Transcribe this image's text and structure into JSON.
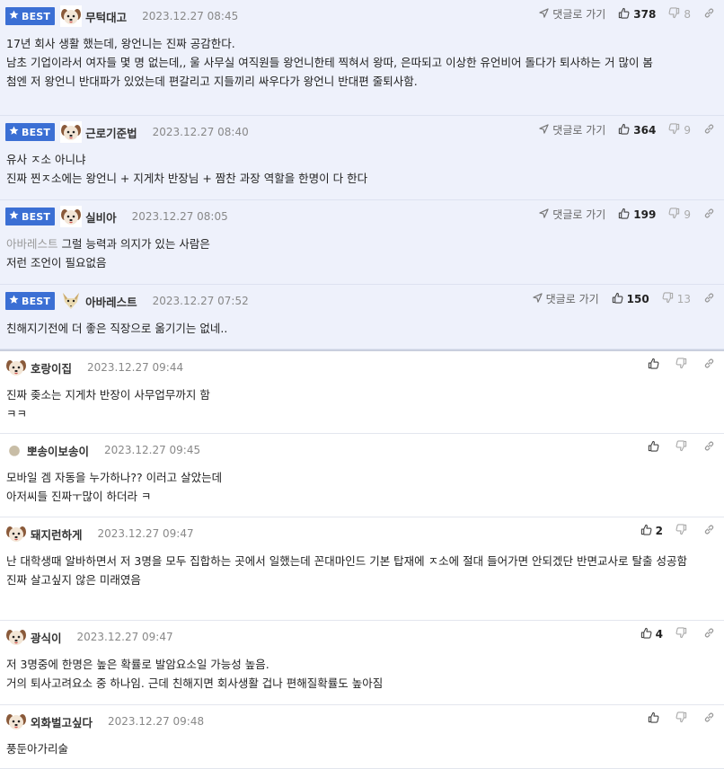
{
  "ui": {
    "best_label": "BEST",
    "reply_label": "댓글로 가기"
  },
  "comments": [
    {
      "best": true,
      "avatar": "puppy",
      "nick": "무턱대고",
      "date": "2023.12.27 08:45",
      "up": "378",
      "down": "8",
      "lines": [
        "17년 회사 생활 했는데, 왕언니는 진짜 공감한다.",
        "남초 기업이라서 여자들 몇 명 없는데,, 울 사무실 여직원들 왕언니한테 찍혀서 왕따, 은따되고 이상한 유언비어 돌다가 퇴사하는 거 많이 봄",
        "첨엔 저 왕언니 반대파가 있었는데 편갈리고 지들끼리 싸우다가 왕언니 반대편 줄퇴사함."
      ]
    },
    {
      "best": true,
      "avatar": "puppy",
      "nick": "근로기준법",
      "date": "2023.12.27 08:40",
      "up": "364",
      "down": "9",
      "lines": [
        "유사 ㅈ소 아니냐",
        "진짜 찐ㅈ소에는 왕언니 + 지게차 반장님 + 짬찬 과장 역할을 한명이 다 한다"
      ]
    },
    {
      "best": true,
      "avatar": "puppy",
      "nick": "실비아",
      "date": "2023.12.27 08:05",
      "up": "199",
      "down": "9",
      "mention": "아바레스트",
      "lines": [
        "그럴 능력과 의지가 있는 사람은",
        "저런 조언이 필요없음"
      ]
    },
    {
      "best": true,
      "avatar": "fox",
      "nick": "아바레스트",
      "date": "2023.12.27 07:52",
      "up": "150",
      "down": "13",
      "lines": [
        "친해지기전에 더 좋은 직장으로 옮기기는 없네.."
      ]
    },
    {
      "best": false,
      "avatar": "puppy",
      "nick": "호랑이집",
      "date": "2023.12.27 09:44",
      "up": "",
      "down": "",
      "lines": [
        "진짜 좆소는 지게차 반장이 사무업무까지 함",
        "ㅋㅋ"
      ]
    },
    {
      "best": false,
      "avatar": "dot",
      "nick": "뽀송이보송이",
      "date": "2023.12.27 09:45",
      "up": "",
      "down": "",
      "lines": [
        "모바일 겜 자동을 누가하나?? 이러고 살았는데",
        "아저씨들 진짜ㅜ많이 하더라 ㅋ"
      ]
    },
    {
      "best": false,
      "avatar": "puppy",
      "nick": "돼지런하게",
      "date": "2023.12.27 09:47",
      "up": "2",
      "down": "",
      "lines": [
        "난 대학생때 알바하면서 저 3명을 모두 집합하는 곳에서 일했는데 꼰대마인드 기본 탑재에 ㅈ소에 절대 들어가면 안되겠단 반면교사로 탈출 성공함",
        "진짜 살고싶지 않은 미래였음"
      ]
    },
    {
      "best": false,
      "avatar": "puppy",
      "nick": "광식이",
      "date": "2023.12.27 09:47",
      "up": "4",
      "down": "",
      "lines": [
        "저 3명중에 한명은 높은 확률로 발암요소일 가능성 높음.",
        "거의 퇴사고려요소 중 하나임. 근데 친해지면 회사생활 겁나 편해질확률도 높아짐"
      ]
    },
    {
      "best": false,
      "avatar": "puppy",
      "nick": "외화벌고싶다",
      "date": "2023.12.27 09:48",
      "up": "",
      "down": "",
      "lines": [
        "풍둔아가리술"
      ]
    }
  ],
  "icons": {
    "badge_star": "star-icon",
    "reply": "arrow-icon",
    "upvote": "thumbs-up-icon",
    "downvote": "thumbs-down-icon",
    "share": "link-icon",
    "avatar_puppy": "puppy-avatar-icon",
    "avatar_fox": "fox-avatar-icon",
    "avatar_dot": "dot-avatar-icon"
  },
  "colors": {
    "best_bg": "#eef1fb",
    "badge": "#3b6fd4",
    "border": "#e3e6ee"
  }
}
